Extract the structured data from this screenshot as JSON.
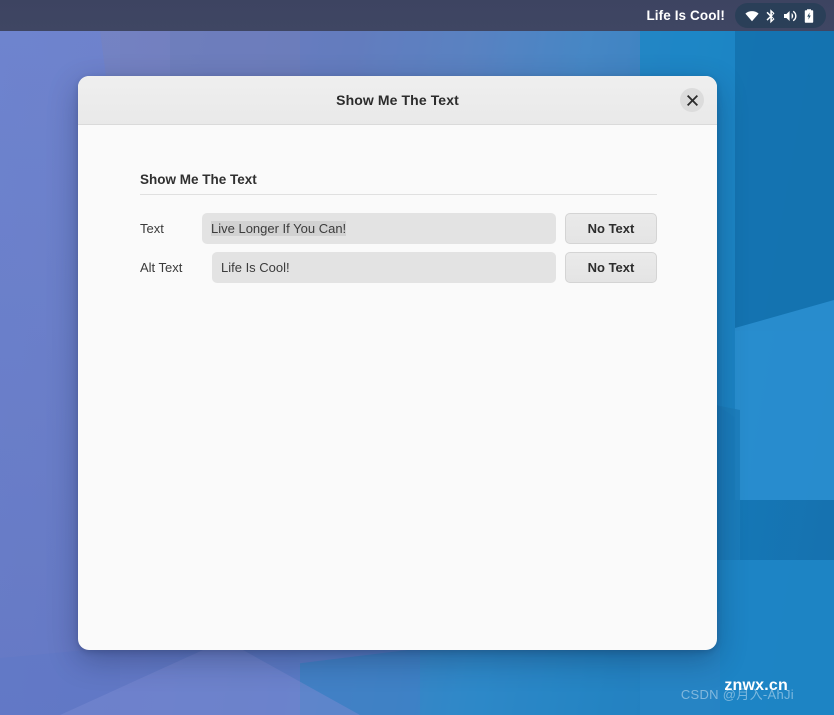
{
  "topbar": {
    "title": "Life Is Cool!",
    "indicators": [
      {
        "name": "wifi-icon",
        "label": "Wi-Fi"
      },
      {
        "name": "bluetooth-icon",
        "label": "Bluetooth"
      },
      {
        "name": "volume-icon",
        "label": "Volume"
      },
      {
        "name": "battery-icon",
        "label": "Battery charging"
      }
    ],
    "background_color": "#3e4562"
  },
  "dialog": {
    "title": "Show Me The Text",
    "close_label": "×",
    "titlebar_color": "#ececec",
    "body_color": "#fafafa",
    "section_header": "Show Me The Text",
    "rows": [
      {
        "label": "Text",
        "value": "Live Longer If You Can!",
        "placeholder": "",
        "selected": true,
        "button_label": "No Text"
      },
      {
        "label": "Alt Text",
        "value": "Life Is Cool!",
        "placeholder": "",
        "selected": false,
        "button_label": "No Text"
      }
    ]
  },
  "watermarks": {
    "primary": "znwx.cn",
    "secondary": "CSDN @月入-AhJi"
  },
  "desktop": {
    "accent_color": "#1e86c6",
    "left_color": "#6d82cc"
  }
}
